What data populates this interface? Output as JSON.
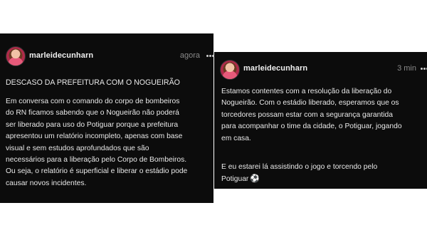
{
  "posts": [
    {
      "username": "marleidecunharn",
      "timestamp": "agora",
      "title": "DESCASO DA PREFEITURA COM O NOGUEIRÃO",
      "body": "Em conversa com o comando do corpo de bombeiros\ndo RN ficamos sabendo que o Nogueirão não poderá\nser liberado para uso do Potiguar porque a prefeitura\napresentou um relatório incompleto, apenas com base\nvisual e sem estudos aprofundados que são\nnecessários para a liberação pelo Corpo de Bombeiros.\nOu seja, o relatório é superficial e liberar o estádio pode\ncausar novos incidentes."
    },
    {
      "username": "marleidecunharn",
      "timestamp": "3 min",
      "body": "Estamos contentes com a resolução da liberação do\nNogueirão. Com o estádio liberado, esperamos que os\ntorcedores possam estar com a segurança garantida\npara acompanhar o time da cidade, o Potiguar, jogando\nem casa.",
      "body2": "E eu estarei lá assistindo o jogo e torcendo pelo\nPotiguar",
      "emoji": "⚽"
    }
  ],
  "icons": {
    "more": "more-horizontal-icon",
    "soccer": "soccer-ball-icon"
  }
}
